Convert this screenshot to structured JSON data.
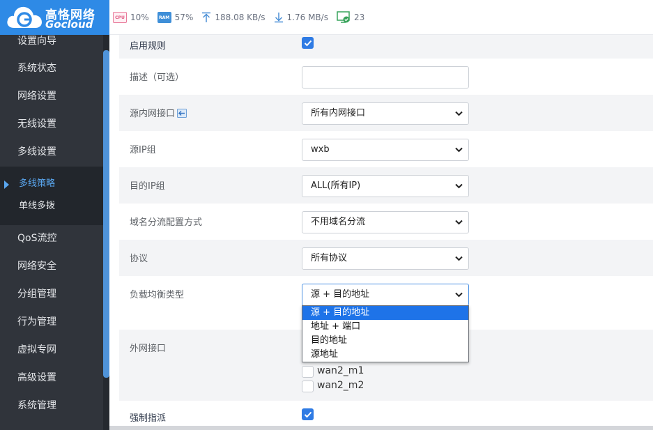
{
  "brand": {
    "name_cn": "高恪网络",
    "name_en": "Gocloud"
  },
  "stats": {
    "cpu_chip": "CPU",
    "cpu": "10%",
    "ram_chip": "RAM",
    "ram": "57%",
    "upload": "188.08 KB/s",
    "download": "1.76 MB/s",
    "connected": "23"
  },
  "sidebar": {
    "items": [
      "设置向导",
      "系统状态",
      "网络设置",
      "无线设置",
      "多线设置"
    ],
    "group": {
      "children": [
        "多线策略",
        "单线多拨"
      ],
      "active": "多线策略"
    },
    "items_after": [
      "QoS流控",
      "网络安全",
      "分组管理",
      "行为管理",
      "虚拟专网",
      "高级设置",
      "系统管理"
    ]
  },
  "form": {
    "enable_rule": {
      "label": "启用规则",
      "checked": true
    },
    "description": {
      "label": "描述（可选）",
      "value": ""
    },
    "src_lan_iface": {
      "label": "源内网接口",
      "value": "所有内网接口"
    },
    "src_ip_group": {
      "label": "源IP组",
      "value": "wxb"
    },
    "dst_ip_group": {
      "label": "目的IP组",
      "value": "ALL(所有IP)"
    },
    "domain_mode": {
      "label": "域名分流配置方式",
      "value": "不用域名分流"
    },
    "protocol": {
      "label": "协议",
      "value": "所有协议"
    },
    "lb_type": {
      "label": "负载均衡类型",
      "value": "源 + 目的地址",
      "options": [
        "源 + 目的地址",
        "地址 + 端口",
        "目的地址",
        "源地址"
      ],
      "selected_index": 0
    },
    "wan_iface": {
      "label": "外网接口",
      "options": [
        "wan2_m1",
        "wan2_m2"
      ]
    },
    "force_assign": {
      "label": "强制指派",
      "checked": true
    }
  },
  "colors": {
    "accent": "#2e8ae6",
    "sidebar_bg": "#30343b",
    "checkbox": "#2f7be4"
  }
}
